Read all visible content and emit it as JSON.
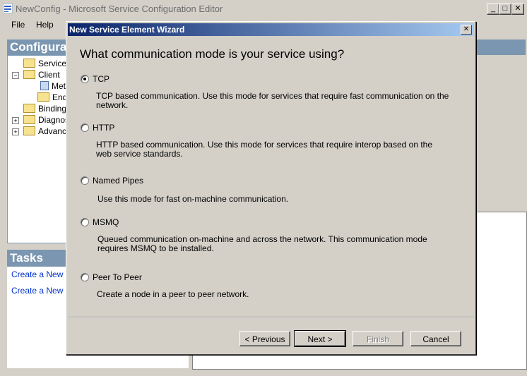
{
  "window": {
    "title": "NewConfig - Microsoft Service Configuration Editor",
    "minimize": "_",
    "maximize": "□",
    "close": "✕"
  },
  "menu": {
    "file": "File",
    "help": "Help"
  },
  "left_pane": {
    "header": "Configurat",
    "tree": [
      {
        "label": "Services"
      },
      {
        "label": "Client",
        "expanded": true
      },
      {
        "label": "Met"
      },
      {
        "label": "End"
      },
      {
        "label": "Bindings"
      },
      {
        "label": "Diagnos",
        "expander": "+"
      },
      {
        "label": "Advance",
        "expander": "+"
      }
    ],
    "tasks_header": "Tasks",
    "tasks": [
      "Create a New Se",
      "Create a New Cl"
    ]
  },
  "dialog": {
    "title": "New Service Element Wizard",
    "close": "✕",
    "question": "What communication mode is your service using?",
    "options": [
      {
        "label": "TCP",
        "selected": true,
        "desc": "TCP based communication. Use this mode for services that require fast communication on the network."
      },
      {
        "label": "HTTP",
        "selected": false,
        "desc": "HTTP based communication. Use this mode for services that require interop based on the web service standards."
      },
      {
        "label": "Named Pipes",
        "selected": false,
        "desc": "Use this mode for fast on-machine communication."
      },
      {
        "label": "MSMQ",
        "selected": false,
        "desc": "Queued communication on-machine and across the network. This communication mode requires MSMQ to be installed."
      },
      {
        "label": "Peer To Peer",
        "selected": false,
        "desc": "Create a node in a peer to peer network."
      }
    ],
    "buttons": {
      "previous": "< Previous",
      "next": "Next >",
      "finish": "Finish",
      "cancel": "Cancel"
    }
  },
  "colors": {
    "title_gradient_start": "#0a246a",
    "title_gradient_end": "#a6caf0",
    "pane_header": "#7a96b0",
    "link": "#0033cc"
  }
}
